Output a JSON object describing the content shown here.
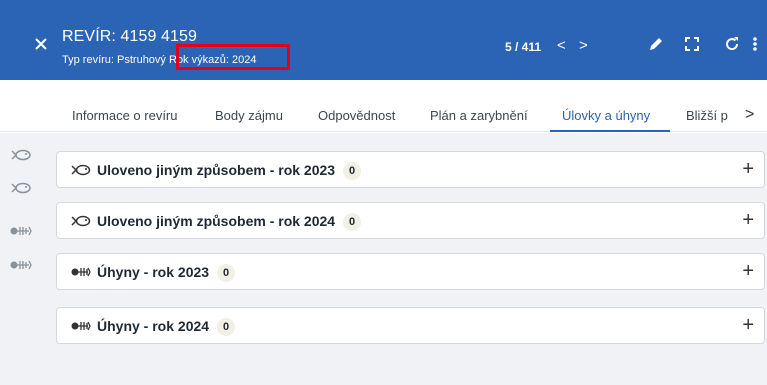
{
  "header": {
    "title": "REVÍR: 4159 4159",
    "subtitle_prefix": "Typ revíru: Pstruhový",
    "subtitle_year": "Rok výkazů: 2024",
    "counter": "5 / 411",
    "prev_glyph": "<",
    "next_glyph": ">",
    "icons": [
      "close-icon",
      "edit-icon",
      "fullscreen-icon",
      "refresh-icon",
      "more-vert-icon"
    ],
    "highlight_color": "#e3001b",
    "background": "#2b63b5"
  },
  "tabs": {
    "items": [
      {
        "label": "Informace o revíru"
      },
      {
        "label": "Body zájmu"
      },
      {
        "label": "Odpovědnost"
      },
      {
        "label": "Plán a zarybnění"
      },
      {
        "label": "Úlovky a úhyny"
      },
      {
        "label": "Bližší p"
      }
    ],
    "active_index": 4,
    "more_glyph": ">"
  },
  "rail": {
    "icons": [
      "fish-icon",
      "fish-icon",
      "fish-bones-icon",
      "fish-bones-icon"
    ]
  },
  "panels": [
    {
      "title": "Uloveno jiným způsobem - rok 2023",
      "count": "0",
      "icon": "fish-icon",
      "toggle": "+"
    },
    {
      "title": "Uloveno jiným způsobem - rok 2024",
      "count": "0",
      "icon": "fish-icon",
      "toggle": "+"
    },
    {
      "title": "Úhyny - rok 2023",
      "count": "0",
      "icon": "fish-bones-icon",
      "toggle": "+"
    },
    {
      "title": "Úhyny - rok 2024",
      "count": "0",
      "icon": "fish-bones-icon",
      "toggle": "+"
    }
  ]
}
